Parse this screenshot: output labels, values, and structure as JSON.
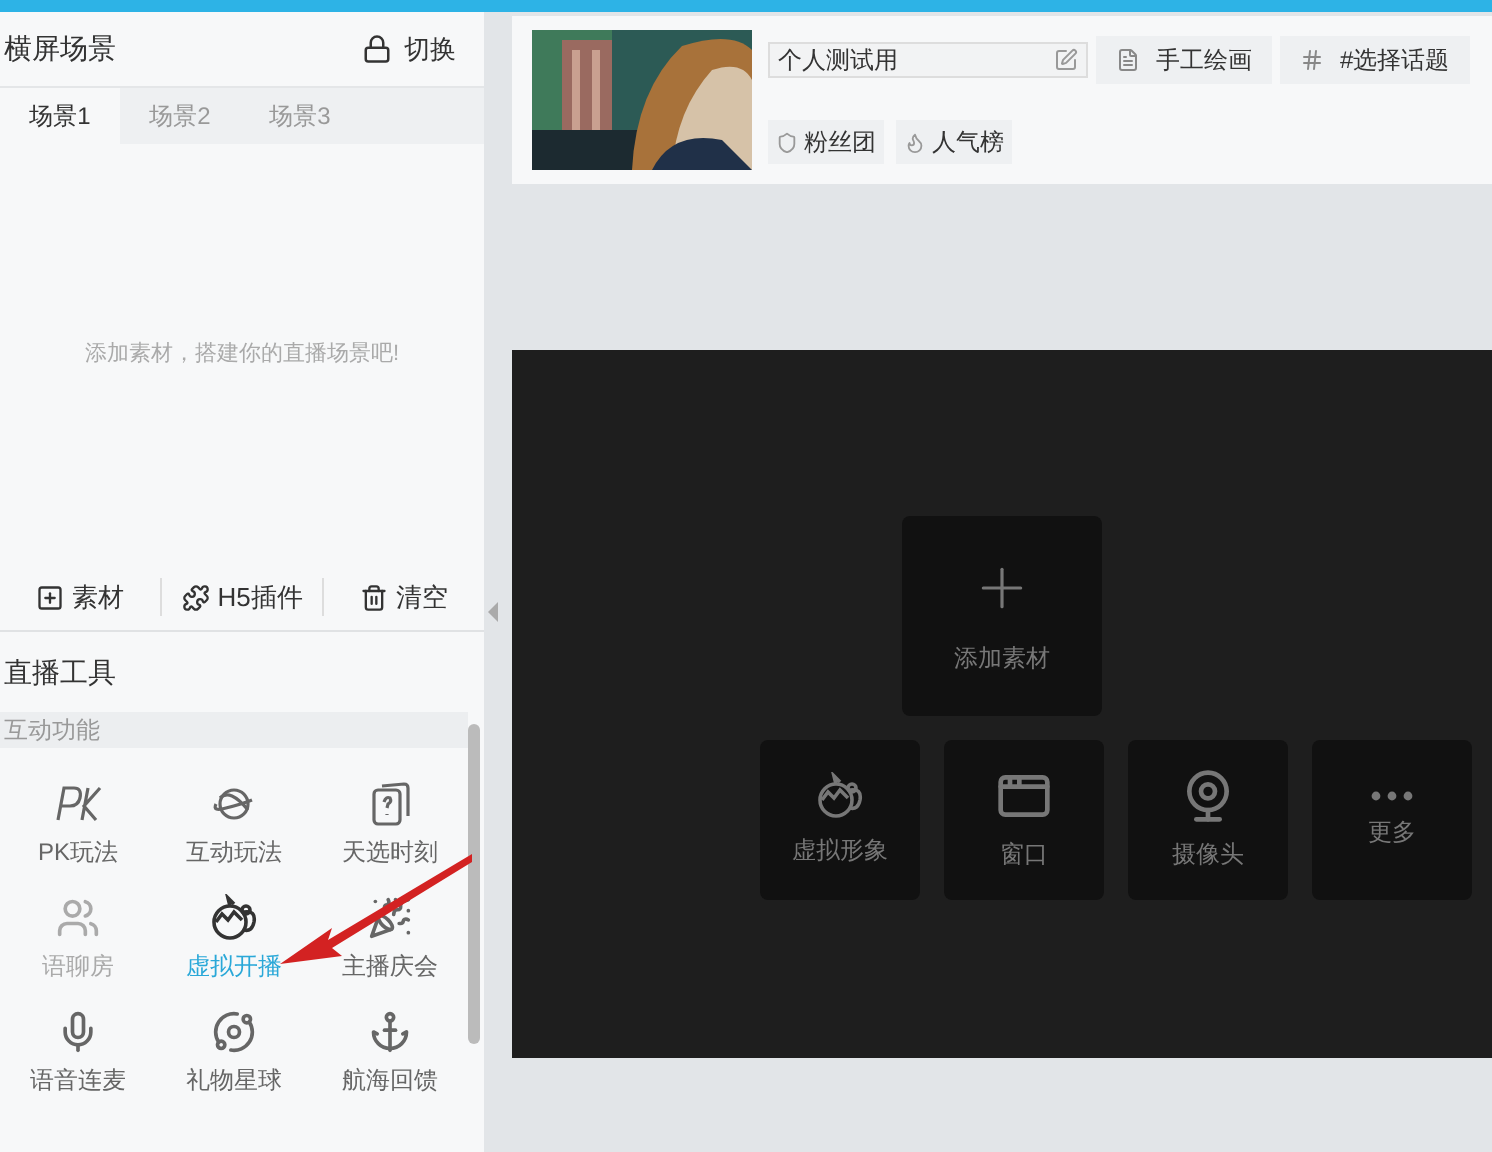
{
  "scene_panel": {
    "title": "横屏场景",
    "switch_button": "切换",
    "tabs": [
      {
        "label": "场景1",
        "selected": true
      },
      {
        "label": "场景2",
        "selected": false
      },
      {
        "label": "场景3",
        "selected": false
      }
    ],
    "empty_hint": "添加素材，搭建你的直播场景吧!",
    "toolbar": [
      "素材",
      "H5插件",
      "清空"
    ]
  },
  "tools_panel": {
    "title": "直播工具",
    "section": "互动功能",
    "items": [
      {
        "label": "PK玩法",
        "selected": false,
        "disabled": false
      },
      {
        "label": "互动玩法",
        "selected": false,
        "disabled": false
      },
      {
        "label": "天选时刻",
        "selected": false,
        "disabled": false
      },
      {
        "label": "语聊房",
        "selected": false,
        "disabled": true
      },
      {
        "label": "虚拟开播",
        "selected": true,
        "disabled": false
      },
      {
        "label": "主播庆会",
        "selected": false,
        "disabled": false
      },
      {
        "label": "语音连麦",
        "selected": false,
        "disabled": false
      },
      {
        "label": "礼物星球",
        "selected": false,
        "disabled": false
      },
      {
        "label": "航海回馈",
        "selected": false,
        "disabled": false
      }
    ]
  },
  "room_info": {
    "title_field": {
      "value": "个人测试用"
    },
    "tags": [
      "手工绘画",
      "#选择话题"
    ],
    "badges": [
      "粉丝团",
      "人气榜"
    ]
  },
  "preview": {
    "add_card": "添加素材",
    "sources": [
      "虚拟形象",
      "窗口",
      "摄像头",
      "更多"
    ]
  }
}
